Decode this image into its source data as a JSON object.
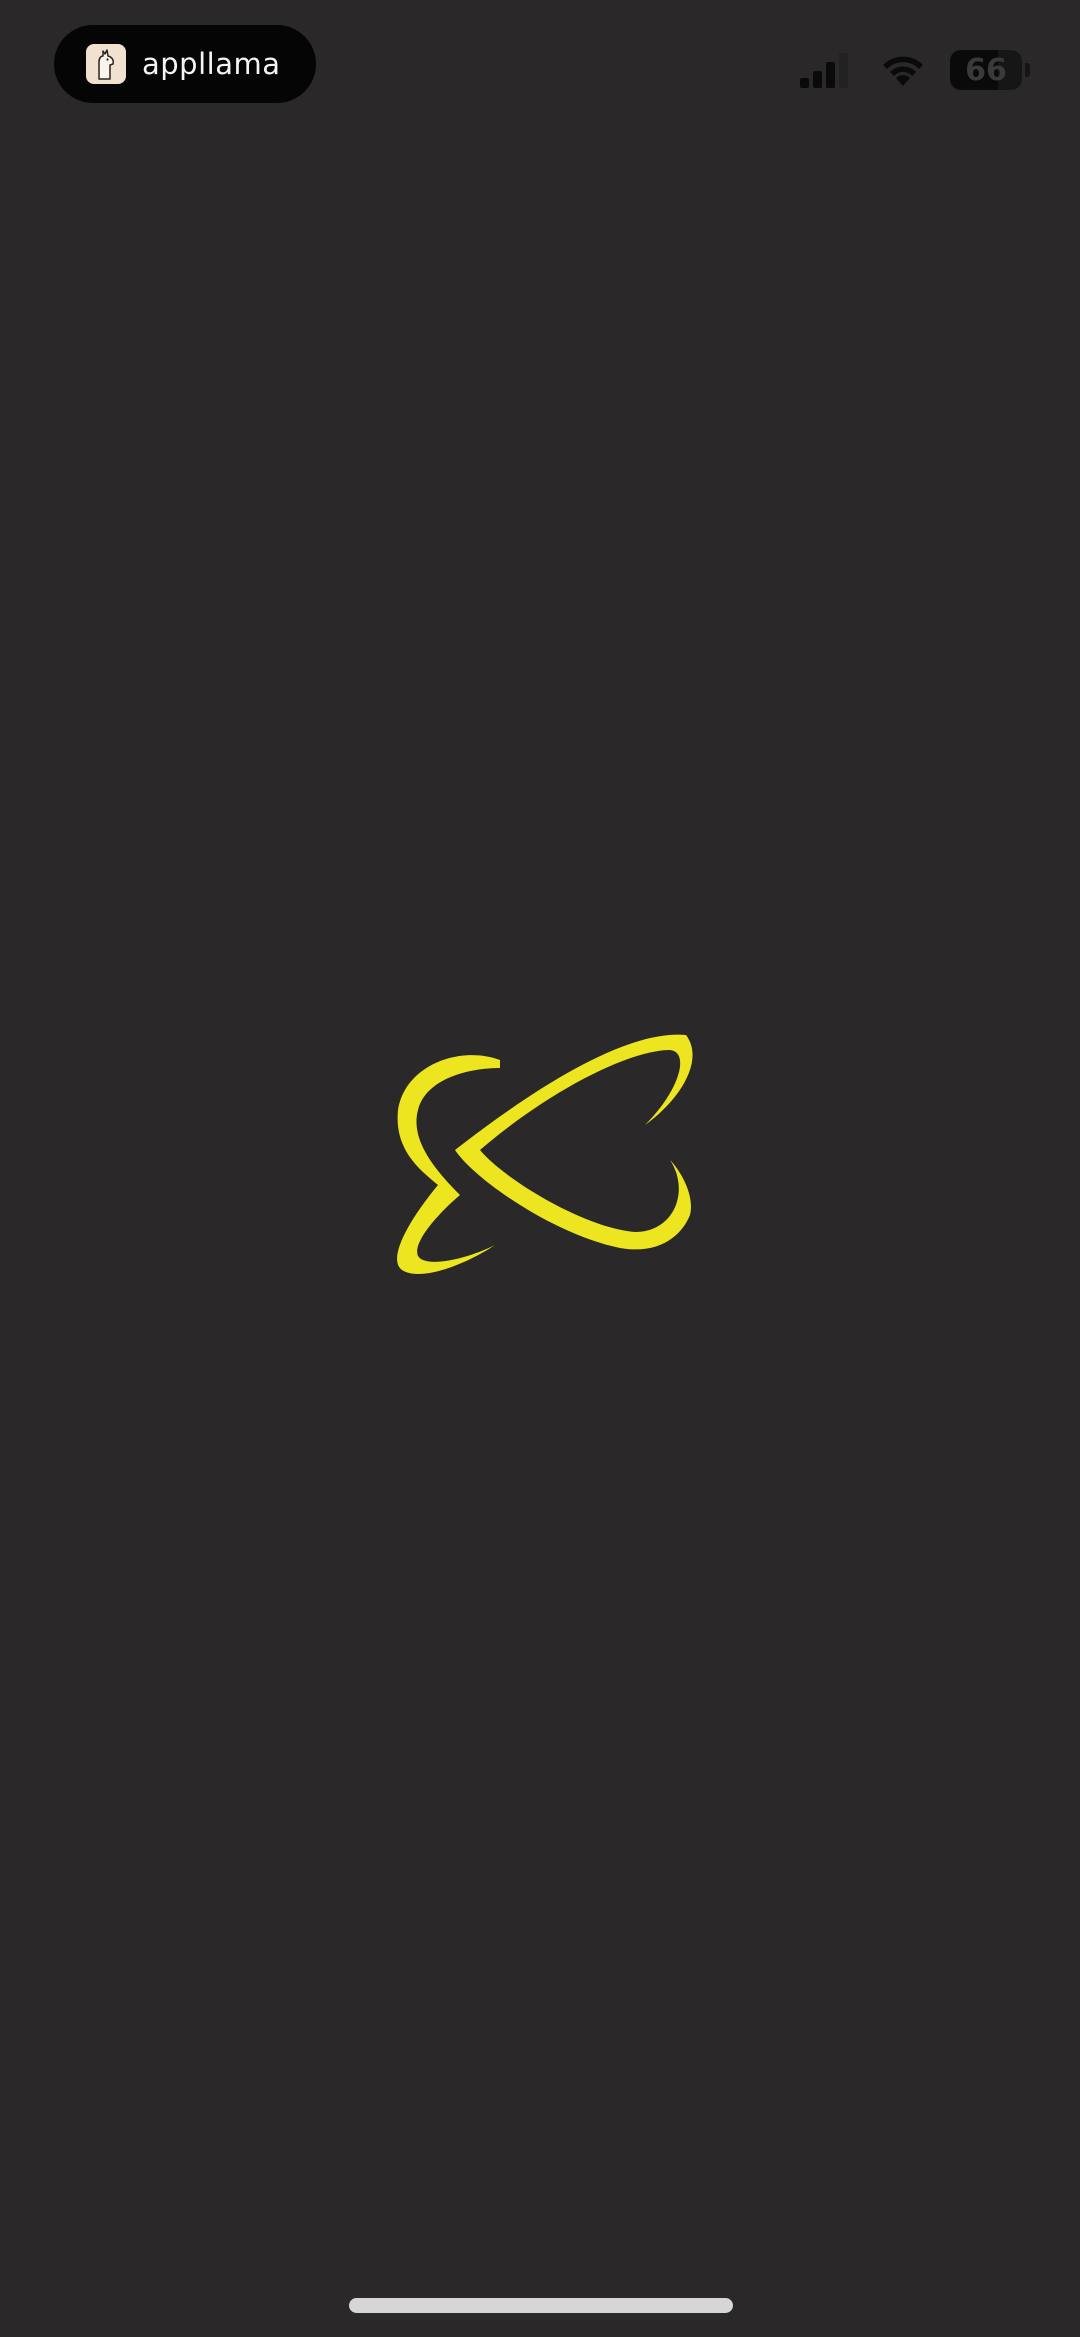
{
  "status_bar": {
    "brand_name": "appllama",
    "battery_level": "66",
    "battery_fraction": 0.66,
    "icons": [
      "llama-icon",
      "signal-icon",
      "wifi-icon",
      "battery-icon"
    ]
  },
  "splash": {
    "logo_icon": "yellow-orbit-x-logo-icon",
    "logo_color": "#ece51f",
    "background_color": "#2a2829"
  },
  "home_indicator_color": "#d6d6d6"
}
